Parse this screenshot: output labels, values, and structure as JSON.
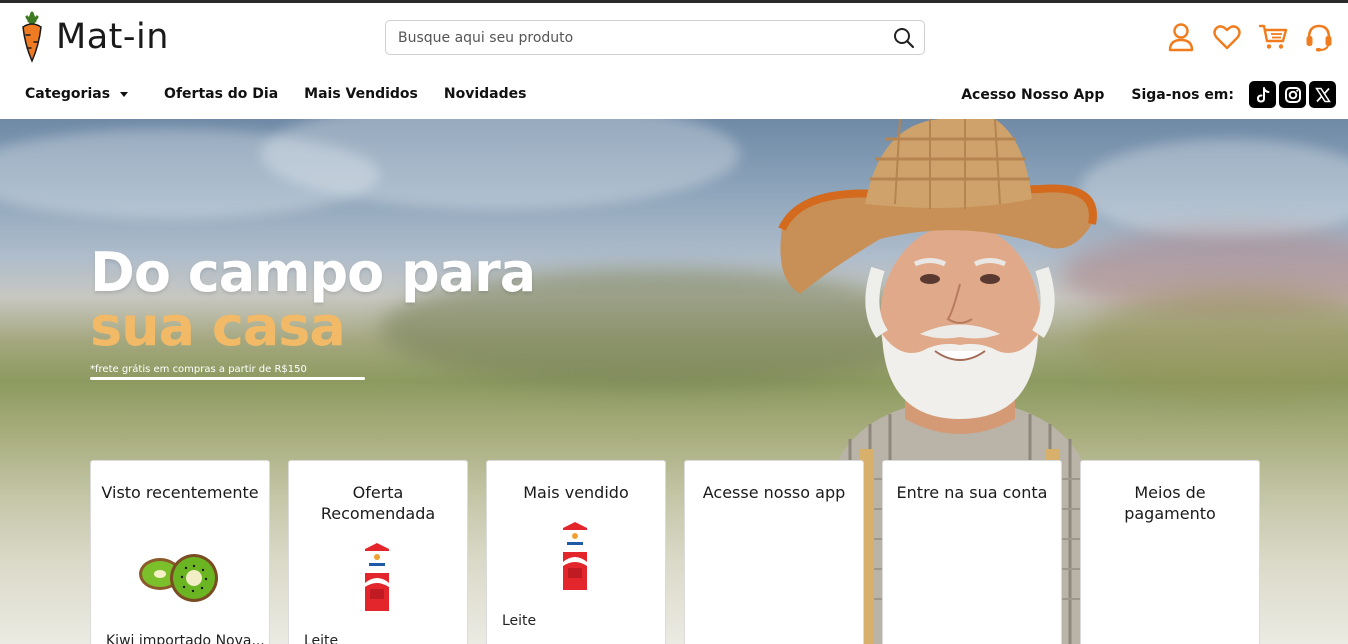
{
  "brand": {
    "name": "Mat-in",
    "accent": "#f07c1e"
  },
  "search": {
    "placeholder": "Busque aqui seu produto"
  },
  "header_icons": [
    "user-icon",
    "heart-icon",
    "cart-icon",
    "headset-icon"
  ],
  "nav": {
    "categories": "Categorias",
    "offers": "Ofertas do Dia",
    "best_sellers": "Mais Vendidos",
    "news": "Novidades",
    "app": "Acesso Nosso App",
    "follow": "Siga-nos em:",
    "social": [
      "tiktok-icon",
      "instagram-icon",
      "x-icon"
    ]
  },
  "hero": {
    "line1": "Do campo para",
    "line2": "sua casa",
    "note": "*frete grátis em compras a partir de R$150"
  },
  "cards": [
    {
      "title": "Visto recentemente",
      "caption": "Kiwi importado Nova..."
    },
    {
      "title": "Oferta Recomendada",
      "caption": "Leite"
    },
    {
      "title": "Mais vendido",
      "caption": "Leite"
    },
    {
      "title": "Acesse nosso app",
      "caption": ""
    },
    {
      "title": "Entre na sua conta",
      "caption": ""
    },
    {
      "title": "Meios de pagamento",
      "caption": ""
    }
  ]
}
